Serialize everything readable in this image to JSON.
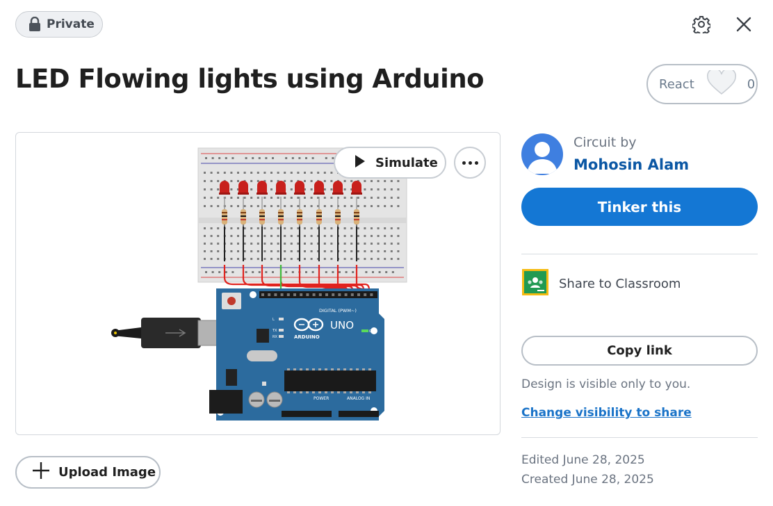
{
  "privacy": {
    "label": "Private",
    "icon": "lock-icon"
  },
  "top_actions": {
    "settings_icon": "gear-icon",
    "close_icon": "close-icon"
  },
  "title": "LED Flowing lights using Arduino",
  "react": {
    "label": "React",
    "count": "0",
    "icon": "heart-icon"
  },
  "preview": {
    "simulate_label": "Simulate",
    "more_icon": "more-dots-icon",
    "board": {
      "brand": "UNO",
      "maker": "ARDUINO",
      "digital_label": "DIGITAL (PWM~)",
      "power_label": "POWER",
      "analog_label": "ANALOG IN",
      "on_label": "ON",
      "tx_label": "TX",
      "rx_label": "RX",
      "l_label": "L"
    },
    "led_color": "#c8201c",
    "wire_color": "#e0231e",
    "board_color": "#2c6b9e"
  },
  "upload": {
    "label": "Upload Image",
    "icon": "plus-icon"
  },
  "sidebar": {
    "circuit_by": "Circuit by",
    "author": "Mohosin Alam",
    "tinker_label": "Tinker this",
    "classroom_label": "Share to Classroom",
    "classroom_icon": "google-classroom-icon",
    "copy_link_label": "Copy link",
    "visibility_note": "Design is visible only to you.",
    "change_visibility_label": "Change visibility to share",
    "edited": "Edited June 28, 2025",
    "created": "Created June 28, 2025"
  },
  "colors": {
    "accent": "#1477d4",
    "link": "#0b57a4"
  }
}
